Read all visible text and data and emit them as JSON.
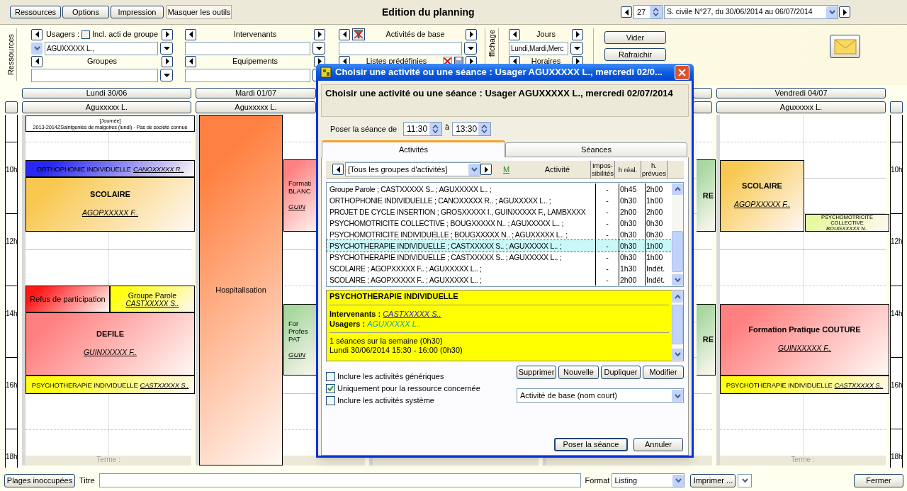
{
  "toolbar": {
    "buttons": [
      {
        "label": "Ressources",
        "pressed": false
      },
      {
        "label": "Options",
        "pressed": false
      },
      {
        "label": "Impression",
        "pressed": false
      },
      {
        "label": "Masquer les outils",
        "pressed": true
      }
    ],
    "title": "Edition du planning",
    "week": {
      "number": "27",
      "range": "S. civile N°27, du 30/06/2014 au 06/07/2014"
    }
  },
  "filters": {
    "section_label": "Ressources",
    "usagers": {
      "label": "Usagers :",
      "group_checkbox": {
        "label": "Incl. acti de groupe",
        "checked": false
      },
      "value": "AGUXXXXX L.,"
    },
    "groupes": {
      "label": "Groupes"
    },
    "intervenants": {
      "label": "Intervenants"
    },
    "equipements": {
      "label": "Equipements"
    },
    "activites": {
      "label": "Activités de base"
    },
    "listes": {
      "label": "Listes prédéfinies"
    },
    "display_label": "ffichage",
    "jours": {
      "label": "Jours",
      "value": "Lundi,Mardi,Merc"
    },
    "horaires": {
      "label": "Horaires"
    },
    "buttons": [
      "Vider",
      "Rafraichir"
    ]
  },
  "calendar": {
    "left_hours": [
      "10h",
      "12h",
      "14h",
      "16h",
      "18h"
    ],
    "right_hours": [
      "10h",
      "12h",
      "14h",
      "16h",
      "18h"
    ],
    "days": [
      {
        "header": "Lundi 30/06",
        "user": "Aguxxxxx L.",
        "footer": "Terme :",
        "events": [
          {
            "kind": "note",
            "lines": [
              "[Journée]",
              "2013-2014ZSaintgeniès de malgoires (lundi) - Pas de société connue"
            ],
            "color": "#ffffff"
          },
          {
            "kind": "inline",
            "title": "ORTHOPHONIE INDIVIDUELLE",
            "person": "CANOXXXXX R..",
            "color": "#2828f0"
          },
          {
            "kind": "block",
            "title": "SCOLAIRE",
            "person": "AGOPXXXXX F..",
            "color": "#f8c850"
          },
          {
            "kind": "plain",
            "title": "Refus de participation",
            "color": "#ff1818"
          },
          {
            "kind": "pair",
            "title": "Groupe Parole",
            "person": "CASTXXXXX S..",
            "color": "#ffff10"
          },
          {
            "kind": "block",
            "title": "DEFILE",
            "person": "GUINXXXXX F..",
            "color": "#ff8080"
          },
          {
            "kind": "inline",
            "title": "PSYCHOTHERAPIE INDIVIDUELLE",
            "person": "CASTXXXXX S..",
            "color": "#ffff10"
          }
        ]
      },
      {
        "header": "Mardi 01/07",
        "user": "Aguxxxxx L.",
        "events": [
          {
            "kind": "plain",
            "title": "Hospitalisation",
            "color": "#ff8040"
          },
          {
            "kind": "fragment",
            "lines": [
              "Formati",
              "BLANC"
            ],
            "person": "GUIN",
            "color": "#ff8080"
          },
          {
            "kind": "fragment",
            "lines": [
              "For",
              "Profes",
              "PAT"
            ],
            "person": "GUIN",
            "color": "#a8d8a0"
          }
        ]
      },
      {
        "events": [
          {
            "kind": "tail",
            "title": "RE",
            "color": "#a8d8a0"
          },
          {
            "kind": "tail",
            "title": "RE",
            "color": "#a8d8a0"
          }
        ]
      },
      {
        "header": "Vendredi 04/07",
        "user": "Aguxxxxx L.",
        "footer": "Terme :",
        "events": [
          {
            "kind": "block",
            "title": "SCOLAIRE",
            "person": "AGOPXXXXX F..",
            "color": "#f8c850"
          },
          {
            "kind": "inline",
            "title": "PSYCHOMOTRICITE COLLECTIVE",
            "person": "BOUGXXXXX N..",
            "color": "#e8f8a0"
          },
          {
            "kind": "block",
            "title": "Formation Pratique COUTURE",
            "person": "GUINXXXXX F..",
            "color": "#ff8080"
          },
          {
            "kind": "inline",
            "title": "PSYCHOTHERAPIE INDIVIDUELLE",
            "person": "CASTXXXXX S..",
            "color": "#ffff10"
          }
        ]
      }
    ]
  },
  "dialog": {
    "title": "Choisir une activité ou une séance :  Usager AGUXXXXX L., mercredi 02/0...",
    "heading": "Choisir une activité ou une séance :  Usager AGUXXXXX L., mercredi 02/07/2014",
    "time_label": "Poser la séance de",
    "start": "11:30",
    "to_label": "à",
    "end": "13:30",
    "tabs": [
      {
        "label": "Activités",
        "selected": true
      },
      {
        "label": "Séances",
        "selected": false
      }
    ],
    "group_filter": "[Tous les groupes d'activités]",
    "columns": [
      "M",
      "Activité",
      "Impos-sibilités",
      "h réal.",
      "h. prévues"
    ],
    "rows": [
      {
        "activity": "Groupe Parole  ; CASTXXXXX S.. ; AGUXXXXX L.. ;",
        "impossibilities": "-",
        "real": "0h45",
        "planned": "2h00",
        "selected": false
      },
      {
        "activity": "ORTHOPHONIE INDIVIDUELLE  ; CANOXXXXX R.. ; AGUXXXXX L.. ;",
        "impossibilities": "-",
        "real": "0h30",
        "planned": "1h00",
        "selected": false
      },
      {
        "activity": "PROJET DE CYCLE INSERTION  ; GROSXXXXX I., GUINXXXXX F., LAMBXXXX",
        "impossibilities": "-",
        "real": "2h00",
        "planned": "2h00",
        "selected": false
      },
      {
        "activity": "PSYCHOMOTRICITE COLLECTIVE  ; BOUGXXXXX N.. ; AGUXXXXX L.. ;",
        "impossibilities": "-",
        "real": "0h30",
        "planned": "0h30",
        "selected": false
      },
      {
        "activity": "PSYCHOMOTRICITE INDIVIDUELLE  ; BOUGXXXXX N.. ; AGUXXXXX L.. ;",
        "impossibilities": "-",
        "real": "0h30",
        "planned": "0h30",
        "selected": false
      },
      {
        "activity": "PSYCHOTHERAPIE INDIVIDUELLE  ; CASTXXXXX S.. ; AGUXXXXX L.. ;",
        "impossibilities": "-",
        "real": "0h30",
        "planned": "1h00",
        "selected": true
      },
      {
        "activity": "PSYCHOTHERAPIE INDIVIDUELLE  ; CASTXXXXX S.. ; AGUXXXXX L.. ;",
        "impossibilities": "-",
        "real": "0h30",
        "planned": "1h00",
        "selected": false
      },
      {
        "activity": "SCOLAIRE  ; AGOPXXXXX F.. ; AGUXXXXX L.. ;",
        "impossibilities": "-",
        "real": "1h30",
        "planned": "Indét.",
        "selected": false
      },
      {
        "activity": "SCOLAIRE  ; AGOPXXXXX F.. ; AGUXXXXX L.. ;",
        "impossibilities": "-",
        "real": "2h00",
        "planned": "Indét.",
        "selected": false
      }
    ],
    "detail": {
      "title": "PSYCHOTHERAPIE INDIVIDUELLE",
      "intervenants_label": "Intervenants :",
      "intervenants": "CASTXXXXX S..",
      "usagers_label": "Usagers :",
      "usagers": "AGUXXXXX L..",
      "summary": "1 séances sur la semaine (0h30)",
      "session": "Lundi 30/06/2014 15:30 - 16:00 (0h30)"
    },
    "actions": [
      "Supprimer",
      "Nouvelle",
      "Dupliquer",
      "Modifier"
    ],
    "options": [
      {
        "label": "Inclure les activités génériques",
        "checked": false
      },
      {
        "label": "Uniquement pour la ressource concernée",
        "checked": true
      },
      {
        "label": "Inclure les activités système",
        "checked": false
      }
    ],
    "display_select": "Activité de base (nom court)",
    "buttons": [
      "Poser la séance",
      "Annuler"
    ]
  },
  "bottom": {
    "unused_button": "Plages inoccupées",
    "title_label": "Titre",
    "format_label": "Format",
    "format": "Listing",
    "print_button": "Imprimer ...",
    "close_button": "Fermer"
  }
}
